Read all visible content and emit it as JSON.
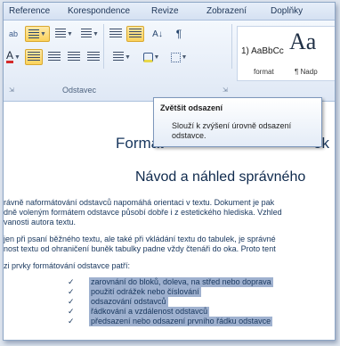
{
  "menu": {
    "tabs": [
      "Reference",
      "Korespondence",
      "Revize",
      "Zobrazení",
      "Doplňky"
    ]
  },
  "ribbon": {
    "group_label": "Odstavec",
    "styles": [
      {
        "sample": "1) AaBbCc",
        "name": "format"
      },
      {
        "sample": "Aa",
        "name": "¶ Nadp"
      }
    ],
    "glyphs": {
      "sort": "A↓",
      "pilcrow": "¶",
      "font_color": "A"
    }
  },
  "tooltip": {
    "title": "Zvětšit odsazení",
    "body": "Slouží k zvýšení úrovně odsazení odstavce."
  },
  "document": {
    "title": "Formát",
    "title_suffix": "ek",
    "subtitle": "Návod a náhled správného",
    "paragraphs": [
      [
        "rávně naformátování odstavců napomáhá orientaci v textu. Dokument je pak",
        "dně voleným formátem odstavce působí dobře i z estetického hlediska. Vzhled",
        "vanosti autora textu."
      ],
      [
        "jen při psaní běžného textu, ale také při vkládání textu do tabulek, je správné",
        "nost textu od ohraničení buněk tabulky padne vždy čtenáři do oka. Proto tent"
      ],
      [
        "zi prvky formátování odstavce patří:"
      ]
    ],
    "bullets": [
      "zarovnání do bloků, doleva, na střed nebo doprava",
      "použití odrážek nebo číslování",
      "odsazování odstavců",
      "řádkování a vzdálenost odstavců",
      "předsazení nebo odsazení prvního řádku odstavce"
    ]
  },
  "colors": {
    "menu_bg": "#d5e1f2",
    "selected_button": "#fbd25c",
    "selection_highlight": "#9fb1cf",
    "document_text": "#17365d"
  }
}
